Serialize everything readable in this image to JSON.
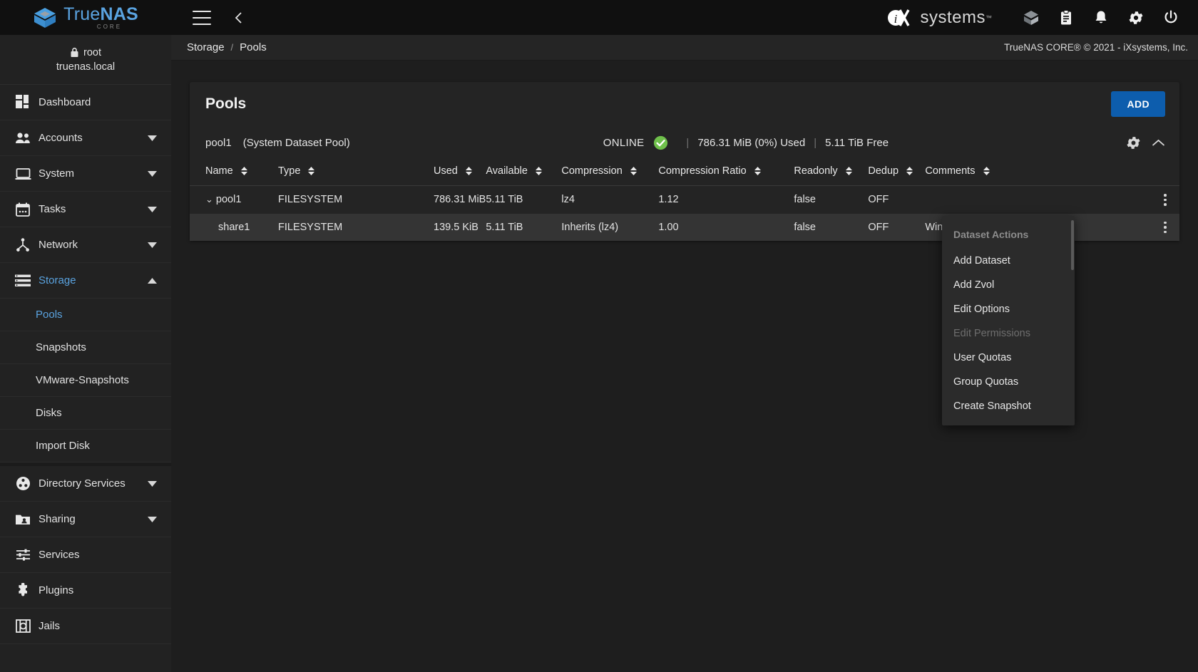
{
  "topbar": {
    "brand_true": "True",
    "brand_nas": "NAS",
    "brand_sub": "CORE",
    "menu_icon": "hamburger-icon",
    "back_icon": "chevron-left-icon",
    "vendor_word": "systems",
    "vendor_tm": "™",
    "icons": [
      "cube-icon",
      "clipboard-icon",
      "bell-icon",
      "gear-icon",
      "power-icon"
    ]
  },
  "sidebar": {
    "user": "root",
    "host": "truenas.local",
    "items": [
      {
        "label": "Dashboard",
        "icon": "dashboard-icon",
        "caret": "",
        "active": false
      },
      {
        "label": "Accounts",
        "icon": "accounts-icon",
        "caret": "▾",
        "active": false
      },
      {
        "label": "System",
        "icon": "system-icon",
        "caret": "▾",
        "active": false
      },
      {
        "label": "Tasks",
        "icon": "tasks-icon",
        "caret": "▾",
        "active": false
      },
      {
        "label": "Network",
        "icon": "network-icon",
        "caret": "▾",
        "active": false
      },
      {
        "label": "Storage",
        "icon": "storage-icon",
        "caret": "▴",
        "active": true
      }
    ],
    "storage_children": [
      {
        "label": "Pools",
        "active": true
      },
      {
        "label": "Snapshots",
        "active": false
      },
      {
        "label": "VMware-Snapshots",
        "active": false
      },
      {
        "label": "Disks",
        "active": false
      },
      {
        "label": "Import Disk",
        "active": false
      }
    ],
    "items_lower": [
      {
        "label": "Directory Services",
        "icon": "directory-icon",
        "caret": "▾"
      },
      {
        "label": "Sharing",
        "icon": "sharing-icon",
        "caret": "▾"
      },
      {
        "label": "Services",
        "icon": "services-icon",
        "caret": ""
      },
      {
        "label": "Plugins",
        "icon": "plugins-icon",
        "caret": ""
      },
      {
        "label": "Jails",
        "icon": "jails-icon",
        "caret": ""
      }
    ]
  },
  "breadcrumb": {
    "parent": "Storage",
    "separator": "/",
    "current": "Pools",
    "copyright": "TrueNAS CORE® © 2021 - iXsystems, Inc."
  },
  "card": {
    "title": "Pools",
    "add_label": "ADD"
  },
  "pool": {
    "name": "pool1",
    "system_dataset": "(System Dataset Pool)",
    "status": "ONLINE",
    "status_icon": "check-circle-icon",
    "status_color": "#6fc04b",
    "used": "786.31 MiB (0%) Used",
    "free": "5.11 TiB Free",
    "divider": "|",
    "settings_icon": "gear-icon",
    "collapse_icon": "chevron-up-icon"
  },
  "table": {
    "columns": [
      {
        "label": "Name",
        "key": "name"
      },
      {
        "label": "Type",
        "key": "type"
      },
      {
        "label": "Used",
        "key": "used"
      },
      {
        "label": "Available",
        "key": "available"
      },
      {
        "label": "Compression",
        "key": "compression"
      },
      {
        "label": "Compression Ratio",
        "key": "ratio"
      },
      {
        "label": "Readonly",
        "key": "readonly"
      },
      {
        "label": "Dedup",
        "key": "dedup"
      },
      {
        "label": "Comments",
        "key": "comments"
      }
    ],
    "sort_icon": "sort-arrows-icon",
    "rows": [
      {
        "name": "pool1",
        "expand": "⌄",
        "type": "FILESYSTEM",
        "used": "786.31 MiB",
        "available": "5.11 TiB",
        "compression": "lz4",
        "ratio": "1.12",
        "readonly": "false",
        "dedup": "OFF",
        "comments": "",
        "indent": false,
        "highlight": false
      },
      {
        "name": "share1",
        "expand": "",
        "type": "FILESYSTEM",
        "used": "139.5 KiB",
        "available": "5.11 TiB",
        "compression": "Inherits (lz4)",
        "ratio": "1.00",
        "readonly": "false",
        "dedup": "OFF",
        "comments": "Windows SMB Share",
        "indent": true,
        "highlight": true
      }
    ]
  },
  "context_menu": {
    "title": "Dataset Actions",
    "items": [
      {
        "label": "Add Dataset",
        "disabled": false
      },
      {
        "label": "Add Zvol",
        "disabled": false
      },
      {
        "label": "Edit Options",
        "disabled": false
      },
      {
        "label": "Edit Permissions",
        "disabled": true
      },
      {
        "label": "User Quotas",
        "disabled": false
      },
      {
        "label": "Group Quotas",
        "disabled": false
      },
      {
        "label": "Create Snapshot",
        "disabled": false
      }
    ]
  },
  "colors": {
    "accent": "#5aa3e0",
    "button": "#0d5dad",
    "status_green": "#6fc04b",
    "sidebar_bg": "#222222",
    "main_bg": "#1e1e1e",
    "card_bg": "#242424"
  }
}
